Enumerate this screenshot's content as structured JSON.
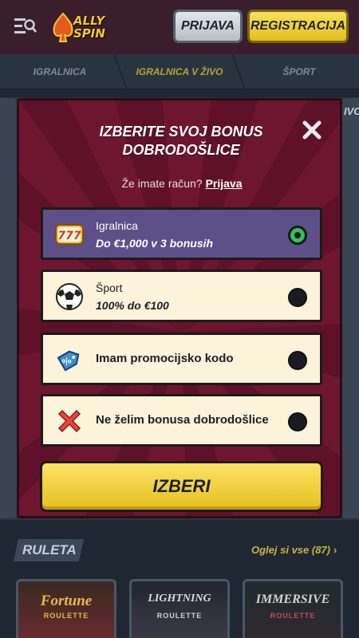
{
  "header": {
    "logo_text_line1": "ALLY",
    "logo_text_line2": "SPIN",
    "login_label": "PRIJAVA",
    "register_label": "REGISTRACIJA"
  },
  "nav": {
    "tabs": [
      {
        "label": "IGRALNICA",
        "active": false
      },
      {
        "label": "IGRALNICA V ŽIVO",
        "active": true
      },
      {
        "label": "ŠPORT",
        "active": false
      }
    ]
  },
  "background": {
    "peek_text": "IVO",
    "section_title": "RULETA",
    "see_all": "Oglej si vse (87)",
    "games": [
      {
        "title": "Fortune",
        "subtitle": "ROULETTE"
      },
      {
        "title": "LIGHTNING",
        "subtitle": "ROULETTE"
      },
      {
        "title": "IMMERSIVE",
        "subtitle": "ROULETTE"
      }
    ]
  },
  "modal": {
    "title_line1": "IZBERITE SVOJ BONUS",
    "title_line2": "DOBRODOŠLICE",
    "account_prompt": "Že imate račun?",
    "account_link": "Prijava",
    "options": [
      {
        "title": "Igralnica",
        "subtitle": "Do €1,000 v 3 bonusih",
        "icon": "slot-777-icon",
        "selected": true
      },
      {
        "title": "Šport",
        "subtitle": "100% do €100",
        "icon": "soccer-ball-icon",
        "selected": false
      },
      {
        "title": "Imam promocijsko kodo",
        "icon": "promo-tag-icon",
        "selected": false
      },
      {
        "title": "Ne želim bonusa dobrodošlice",
        "icon": "cross-icon",
        "selected": false
      }
    ],
    "cta_label": "IZBERI"
  },
  "colors": {
    "modal_bg": "#6e1630",
    "accent_yellow": "#f2cf3a",
    "selected_option": "#5d4f87",
    "radio_checked": "#36c15a"
  }
}
